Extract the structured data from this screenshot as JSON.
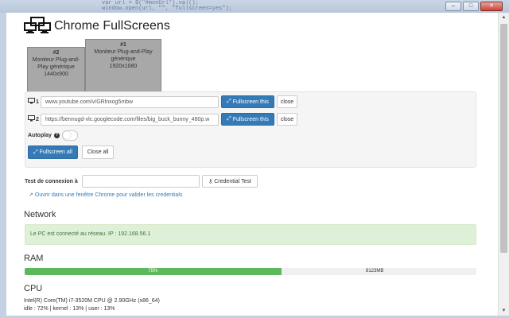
{
  "code_strip": {
    "line1": "var url = $(\"#monUrl\").val();",
    "line2": "window.open(url, \"\", \"fullscreen=yes\");"
  },
  "window_controls": {
    "minimize": "–",
    "maximize": "□",
    "close": "✕"
  },
  "app": {
    "title": "Chrome FullScreens"
  },
  "monitors": [
    {
      "id": "#2",
      "name": "Moniteur Plug-and-Play générique",
      "resolution": "1440x900"
    },
    {
      "id": "#1",
      "name": "Moniteur Plug-and-Play générique",
      "resolution": "1920x1080"
    }
  ],
  "screens": [
    {
      "number": "1",
      "url": "www.youtube.com/v/GRlnxog5mbw",
      "fullscreen_label": "Fullscreen this",
      "close_label": "close"
    },
    {
      "number": "2",
      "url": "https://bennugd-vlc.googlecode.com/files/big_buck_bunny_480p.w",
      "fullscreen_label": "Fullscreen this",
      "close_label": "close"
    }
  ],
  "autoplay": {
    "label": "Autoplay",
    "enabled": false
  },
  "actions": {
    "fullscreen_all": "Fullscreen all",
    "close_all": "Close all"
  },
  "connection": {
    "label": "Test de connexion à",
    "input_value": "",
    "credential_button": "Credential Test",
    "link_text": "Ouvrir dans une fenêtre Chrome pour valider les credentials"
  },
  "network": {
    "title": "Network",
    "status": "Le PC est connecté au réseau. IP : 192.168.56.1"
  },
  "ram": {
    "title": "RAM",
    "percent_label": "75%",
    "used_fraction": 0.75,
    "total": "8123MB"
  },
  "cpu": {
    "title": "CPU",
    "model": "Intel(R) Core(TM) i7-3520M CPU @ 2.90GHz (x86_64)",
    "usage": "idle : 72% | kernel : 13% | user : 13%"
  },
  "colors": {
    "primary": "#337ab7",
    "success": "#5cb85c",
    "alert_bg": "#dff0d8"
  }
}
